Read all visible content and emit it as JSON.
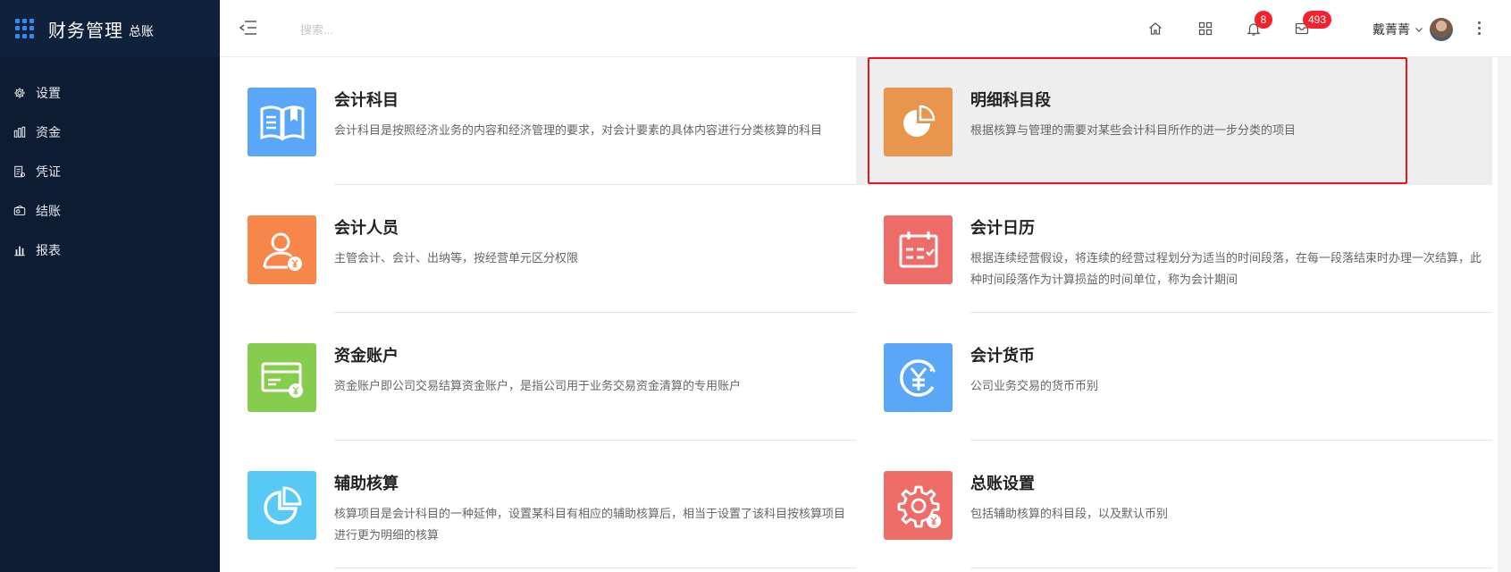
{
  "app": {
    "title": "财务管理",
    "subtitle": "总账"
  },
  "sidebar": {
    "items": [
      {
        "label": "设置",
        "icon": "gear-icon"
      },
      {
        "label": "资金",
        "icon": "bank-icon"
      },
      {
        "label": "凭证",
        "icon": "voucher-icon"
      },
      {
        "label": "结账",
        "icon": "wallet-icon"
      },
      {
        "label": "报表",
        "icon": "bar-chart-icon"
      }
    ]
  },
  "topbar": {
    "search_placeholder": "搜索...",
    "notifications_count": "8",
    "messages_count": "493",
    "user_name": "戴菁菁"
  },
  "cards": [
    {
      "title": "会计科目",
      "desc": "会计科目是按照经济业务的内容和经济管理的要求，对会计要素的具体内容进行分类核算的科目",
      "icon": "book-icon",
      "color": "#5aa6f8"
    },
    {
      "title": "明细科目段",
      "desc": "根据核算与管理的需要对某些会计科目所作的进一步分类的项目",
      "icon": "pie-chart-icon",
      "color": "#e8954d",
      "selected": true
    },
    {
      "title": "会计人员",
      "desc": "主管会计、会计、出纳等，按经营单元区分权限",
      "icon": "accountant-icon",
      "color": "#f7864a"
    },
    {
      "title": "会计日历",
      "desc": "根据连续经营假设，将连续的经营过程划分为适当的时间段落，在每一段落结束时办理一次结算，此种时间段落作为计算损益的时间单位，称为会计期间",
      "icon": "calendar-icon",
      "color": "#ef6d68"
    },
    {
      "title": "资金账户",
      "desc": "资金账户即公司交易结算资金账户，是指公司用于业务交易资金清算的专用账户",
      "icon": "card-account-icon",
      "color": "#85cc4f"
    },
    {
      "title": "会计货币",
      "desc": "公司业务交易的货币币别",
      "icon": "currency-icon",
      "color": "#5aa6f8"
    },
    {
      "title": "辅助核算",
      "desc": "核算项目是会计科目的一种延伸，设置某科目有相应的辅助核算后，相当于设置了该科目按核算项目进行更为明细的核算",
      "icon": "pie-chart-outline-icon",
      "color": "#58c8f5"
    },
    {
      "title": "总账设置",
      "desc": "包括辅助核算的科目段，以及默认币别",
      "icon": "settings-icon",
      "color": "#ef6d68"
    }
  ]
}
